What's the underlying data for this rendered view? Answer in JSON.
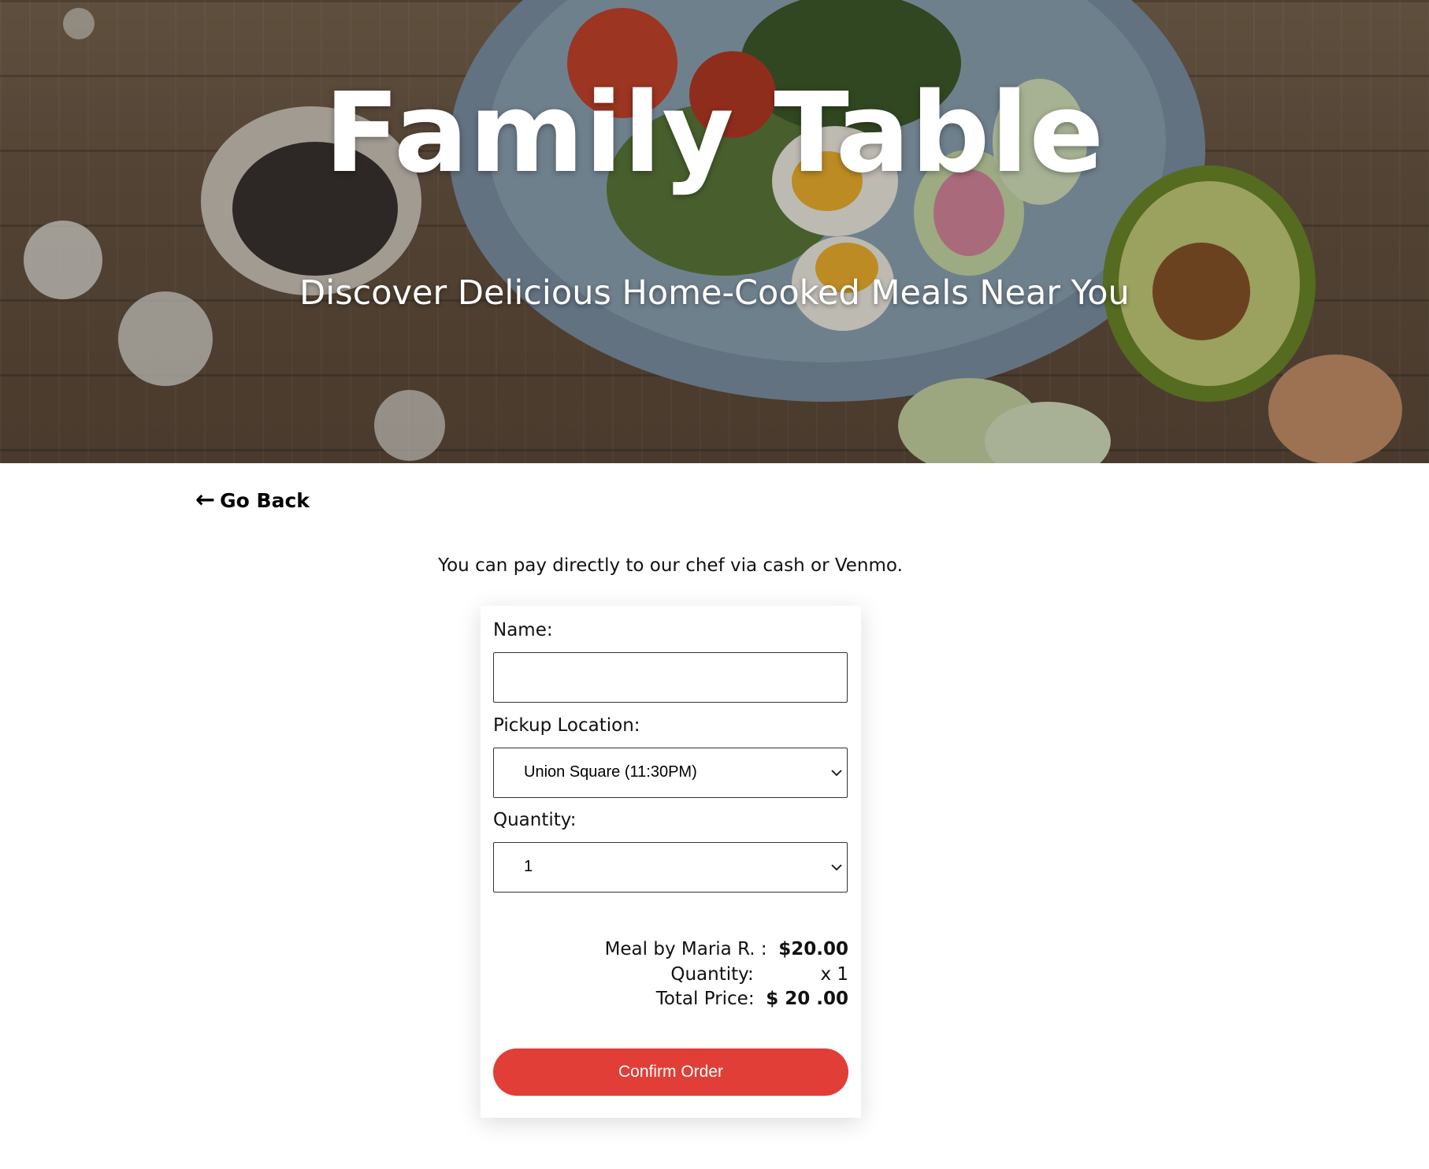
{
  "hero": {
    "title": "Family Table",
    "subtitle": "Discover Delicious Home-Cooked Meals Near You"
  },
  "nav": {
    "back_label": "Go Back"
  },
  "payment_note": "You can pay directly to our chef via cash or Venmo.",
  "form": {
    "name_label": "Name:",
    "name_value": "",
    "location_label": "Pickup Location:",
    "location_value": "Union Square (11:30PM)",
    "quantity_label": "Quantity:",
    "quantity_value": "1"
  },
  "summary": {
    "meal_label": "Meal by Maria R. :",
    "meal_price": "$20.00",
    "quantity_label": "Quantity:",
    "quantity_value": "x 1",
    "total_label": "Total Price:",
    "total_value": "$ 20 .00"
  },
  "confirm_label": "Confirm Order",
  "colors": {
    "accent": "#e03e36"
  }
}
